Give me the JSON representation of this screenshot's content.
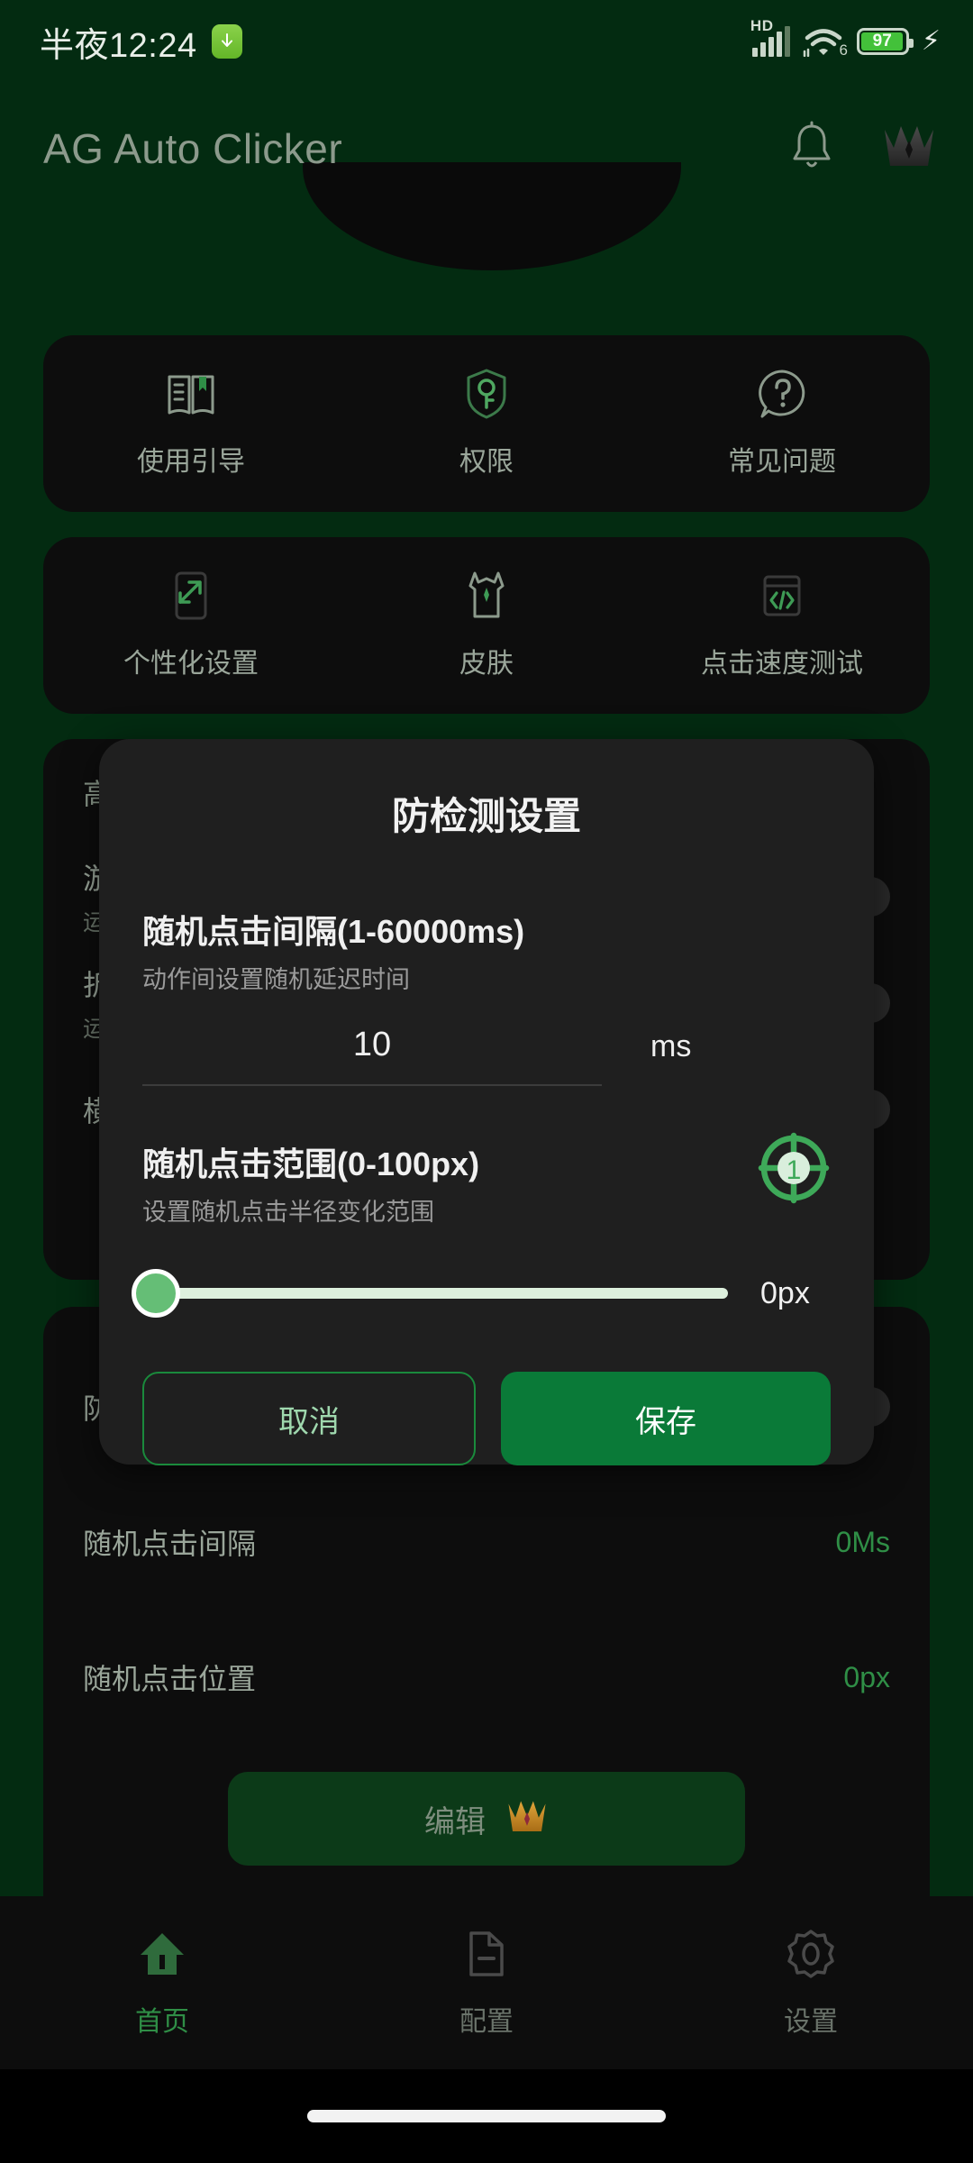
{
  "status_bar": {
    "time": "半夜12:24",
    "download_icon": "download-badge-icon",
    "network_label": "HD",
    "wifi_generation": "6",
    "battery_percent": "97",
    "charging_icon": "lightning-bolt-icon",
    "battery_color": "#43C13A"
  },
  "app_bar": {
    "title": "AG Auto Clicker",
    "notification_icon": "bell-icon",
    "premium_icon": "crown-icon"
  },
  "cards": [
    {
      "name": "help-card",
      "cells": [
        {
          "icon": "book-guide-icon",
          "label": "使用引导"
        },
        {
          "icon": "shield-key-icon",
          "label": "权限"
        },
        {
          "icon": "question-bubble-icon",
          "label": "常见问题"
        }
      ]
    },
    {
      "name": "tools-card",
      "cells": [
        {
          "icon": "phone-expand-icon",
          "label": "个性化设置"
        },
        {
          "icon": "shirt-skin-icon",
          "label": "皮肤"
        },
        {
          "icon": "code-brackets-icon",
          "label": "点击速度测试"
        }
      ]
    }
  ],
  "settings_list": {
    "header": "高",
    "rows": [
      {
        "title": "游",
        "sub": "运"
      },
      {
        "title": "折",
        "sub": "运"
      },
      {
        "title": "横",
        "sub": ""
      }
    ]
  },
  "settings_list2": {
    "rows": [
      {
        "title": "防",
        "value": "",
        "has_toggle": true
      },
      {
        "title": "随机点击间隔",
        "value": "0Ms",
        "has_toggle": false
      },
      {
        "title": "随机点击位置",
        "value": "0px",
        "has_toggle": false
      }
    ],
    "edit_button": {
      "label": "编辑",
      "icon": "crown-icon"
    }
  },
  "dialog": {
    "title": "防检测设置",
    "interval_section": {
      "title": "随机点击间隔(1-60000ms)",
      "subtitle": "动作间设置随机延迟时间",
      "value": "10",
      "placeholder": "10",
      "unit": "ms"
    },
    "range_section": {
      "title": "随机点击范围(0-100px)",
      "subtitle": "设置随机点击半径变化范围",
      "icon": "crosshair-target-icon",
      "icon_badge": "1",
      "slider_value": "0px",
      "slider_min": 0,
      "slider_max": 100,
      "slider_current": 0
    },
    "cancel_label": "取消",
    "save_label": "保存"
  },
  "bottom_nav": {
    "items": [
      {
        "icon": "home-icon",
        "label": "首页",
        "active": true
      },
      {
        "icon": "document-config-icon",
        "label": "配置",
        "active": false
      },
      {
        "icon": "gear-icon",
        "label": "设置",
        "active": false
      }
    ]
  },
  "colors": {
    "background": "#032B11",
    "card": "#0D0D0D",
    "dialog": "#1F1F1F",
    "accent_green": "#0A7A38",
    "active_green": "#2F8E46",
    "slider_thumb": "#65BE76"
  }
}
